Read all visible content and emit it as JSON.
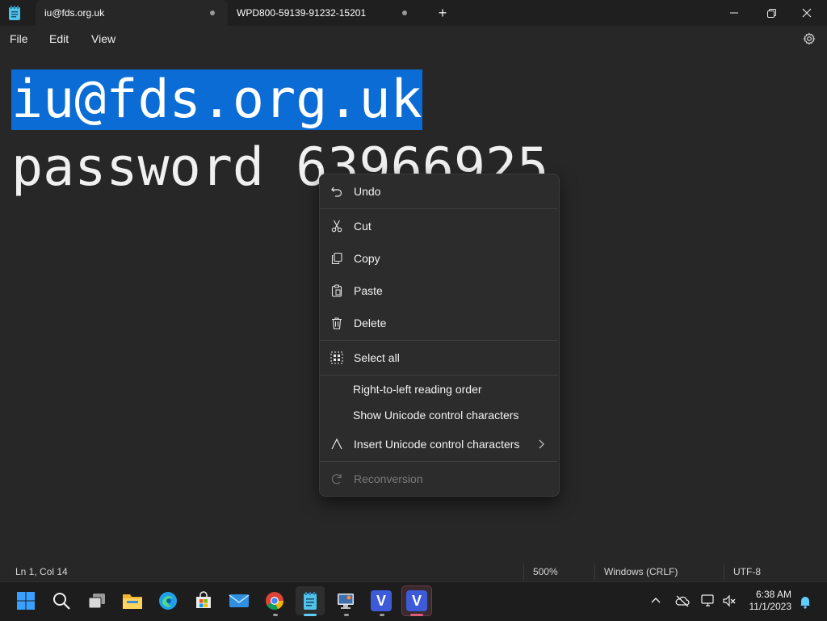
{
  "window": {
    "tabs": [
      {
        "label": "iu@fds.org.uk",
        "active": true
      },
      {
        "label": "WPD800-59139-91232-15201",
        "active": false
      }
    ],
    "new_tab_label": "+"
  },
  "menubar": {
    "file": "File",
    "edit": "Edit",
    "view": "View"
  },
  "editor": {
    "line1": "iu@fds.org.uk",
    "line2": "password 63966925"
  },
  "context_menu": {
    "items": [
      {
        "label": "Undo",
        "icon": "undo-icon"
      },
      {
        "label": "Cut",
        "icon": "scissors-icon"
      },
      {
        "label": "Copy",
        "icon": "copy-icon"
      },
      {
        "label": "Paste",
        "icon": "clipboard-icon"
      },
      {
        "label": "Delete",
        "icon": "trash-icon"
      },
      {
        "label": "Select all",
        "icon": "select-all-icon"
      },
      {
        "label": "Right-to-left reading order"
      },
      {
        "label": "Show Unicode control characters"
      },
      {
        "label": "Insert Unicode control characters",
        "icon": "unicode-icon",
        "submenu": true
      },
      {
        "label": "Reconversion",
        "icon": "reconversion-icon",
        "disabled": true
      }
    ]
  },
  "statusbar": {
    "position": "Ln 1, Col 14",
    "zoom": "500%",
    "line_ending": "Windows (CRLF)",
    "encoding": "UTF-8"
  },
  "taskbar": {
    "time": "6:38 AM",
    "date": "11/1/2023",
    "apps": [
      "start",
      "search",
      "task-view",
      "file-explorer",
      "edge",
      "store",
      "mail",
      "chrome",
      "notepad",
      "remote-desktop",
      "v-app-1",
      "v-app-2"
    ],
    "v_letter": "V"
  },
  "colors": {
    "selection": "#0a6cd4",
    "background": "#272727",
    "accent": "#60cdff"
  }
}
